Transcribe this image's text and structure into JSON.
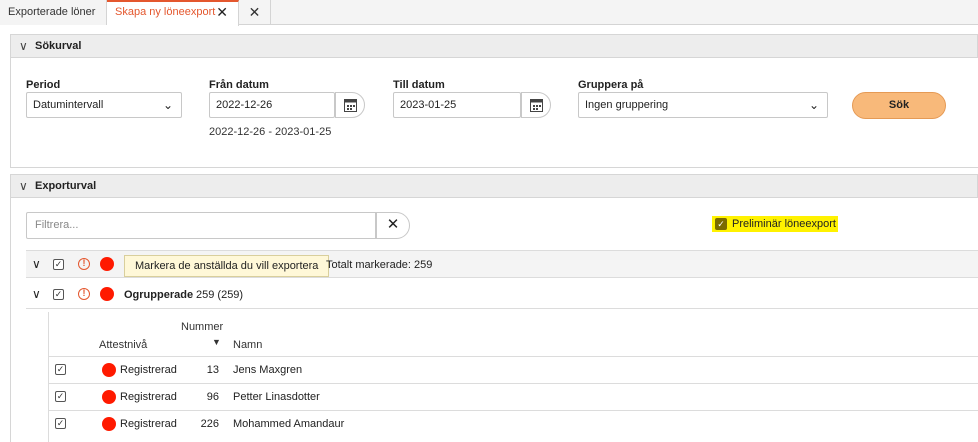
{
  "tabs": [
    {
      "label": "Exporterade löner"
    },
    {
      "label": "Skapa ny löneexport"
    }
  ],
  "search_panel": {
    "title": "Sökurval",
    "period": {
      "label": "Period",
      "value": "Datumintervall"
    },
    "from": {
      "label": "Från datum",
      "value": "2022-12-26"
    },
    "to": {
      "label": "Till datum",
      "value": "2023-01-25"
    },
    "range_text": "2022-12-26 - 2023-01-25",
    "group": {
      "label": "Gruppera på",
      "value": "Ingen gruppering"
    },
    "search_button": "Sök"
  },
  "export_panel": {
    "title": "Exporturval",
    "filter_placeholder": "Filtrera...",
    "preliminary_label": "Preliminär löneexport",
    "tooltip": "Markera de anställda du vill exportera",
    "total_marked": "Totalt markerade: 259",
    "group_name": "Ogrupperade",
    "group_count": "259 (259)",
    "columns": {
      "level": "Attestnivå",
      "number": "Nummer",
      "name": "Namn"
    },
    "rows": [
      {
        "level": "Registrerad",
        "number": "13",
        "name": "Jens Maxgren"
      },
      {
        "level": "Registrerad",
        "number": "96",
        "name": "Petter Linasdotter"
      },
      {
        "level": "Registrerad",
        "number": "226",
        "name": "Mohammed Amandaur"
      }
    ]
  },
  "colors": {
    "accent": "#e4572e",
    "button": "#f8b97a",
    "status_dot": "#ff1a00",
    "highlight": "#fff200"
  }
}
